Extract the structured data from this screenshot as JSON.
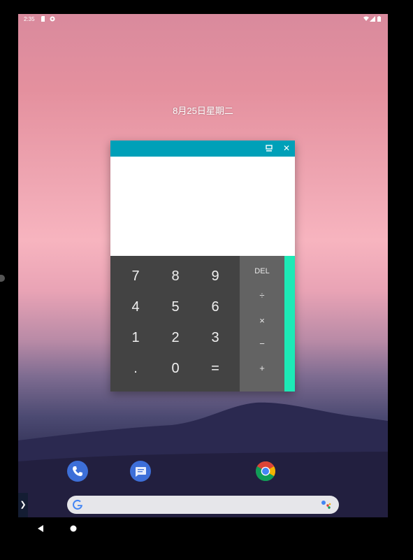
{
  "status_bar": {
    "time": "2:35",
    "left_icons": [
      "sd-card-icon",
      "sync-icon"
    ],
    "right_icons": [
      "wifi-icon",
      "signal-icon",
      "battery-icon"
    ]
  },
  "home": {
    "date": "8月25日星期二"
  },
  "calculator": {
    "titlebar_color": "#00a0b8",
    "display_value": "",
    "titlebar_buttons": [
      "minimize-icon",
      "close-icon"
    ],
    "close_label": "✕",
    "keypad": [
      [
        "7",
        "8",
        "9"
      ],
      [
        "4",
        "5",
        "6"
      ],
      [
        "1",
        "2",
        "3"
      ],
      [
        ".",
        "0",
        "="
      ]
    ],
    "operators": [
      "DEL",
      "÷",
      "×",
      "−",
      "+"
    ],
    "advanced_panel_color": "#1de9b6"
  },
  "dock": {
    "apps": [
      "phone-icon",
      "messages-icon",
      "chrome-icon"
    ]
  },
  "search": {
    "placeholder": "",
    "icons": [
      "google-g-icon",
      "assistant-icon"
    ]
  },
  "drawer_handle": "❯",
  "navbar": {
    "buttons": [
      "back-icon",
      "home-icon"
    ]
  }
}
